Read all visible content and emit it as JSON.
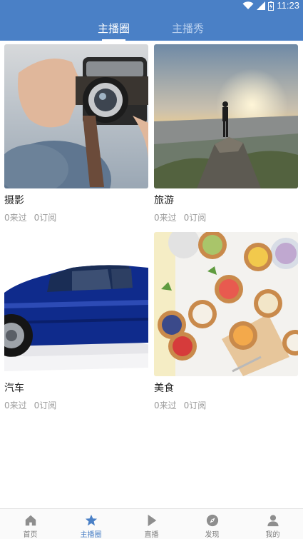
{
  "status_bar": {
    "time": "11:23",
    "icons": [
      "wifi-icon",
      "signal-icon",
      "battery-icon"
    ]
  },
  "header": {
    "tabs": [
      {
        "label": "主播圈",
        "active": true
      },
      {
        "label": "主播秀",
        "active": false
      }
    ],
    "accent_color": "#4a80c6"
  },
  "categories": [
    {
      "title": "摄影",
      "visits": "0来过",
      "subs": "0订阅",
      "image": "camera-photo"
    },
    {
      "title": "旅游",
      "visits": "0来过",
      "subs": "0订阅",
      "image": "mountain-sunset-photo"
    },
    {
      "title": "汽车",
      "visits": "0来过",
      "subs": "0订阅",
      "image": "blue-car-photo"
    },
    {
      "title": "美食",
      "visits": "0来过",
      "subs": "0订阅",
      "image": "fruit-tarts-photo"
    }
  ],
  "bottom_nav": {
    "items": [
      {
        "label": "首页",
        "icon": "home-icon",
        "active": false
      },
      {
        "label": "主播圈",
        "icon": "star-icon",
        "active": true
      },
      {
        "label": "直播",
        "icon": "play-icon",
        "active": false
      },
      {
        "label": "发现",
        "icon": "compass-icon",
        "active": false
      },
      {
        "label": "我的",
        "icon": "person-icon",
        "active": false
      }
    ]
  }
}
